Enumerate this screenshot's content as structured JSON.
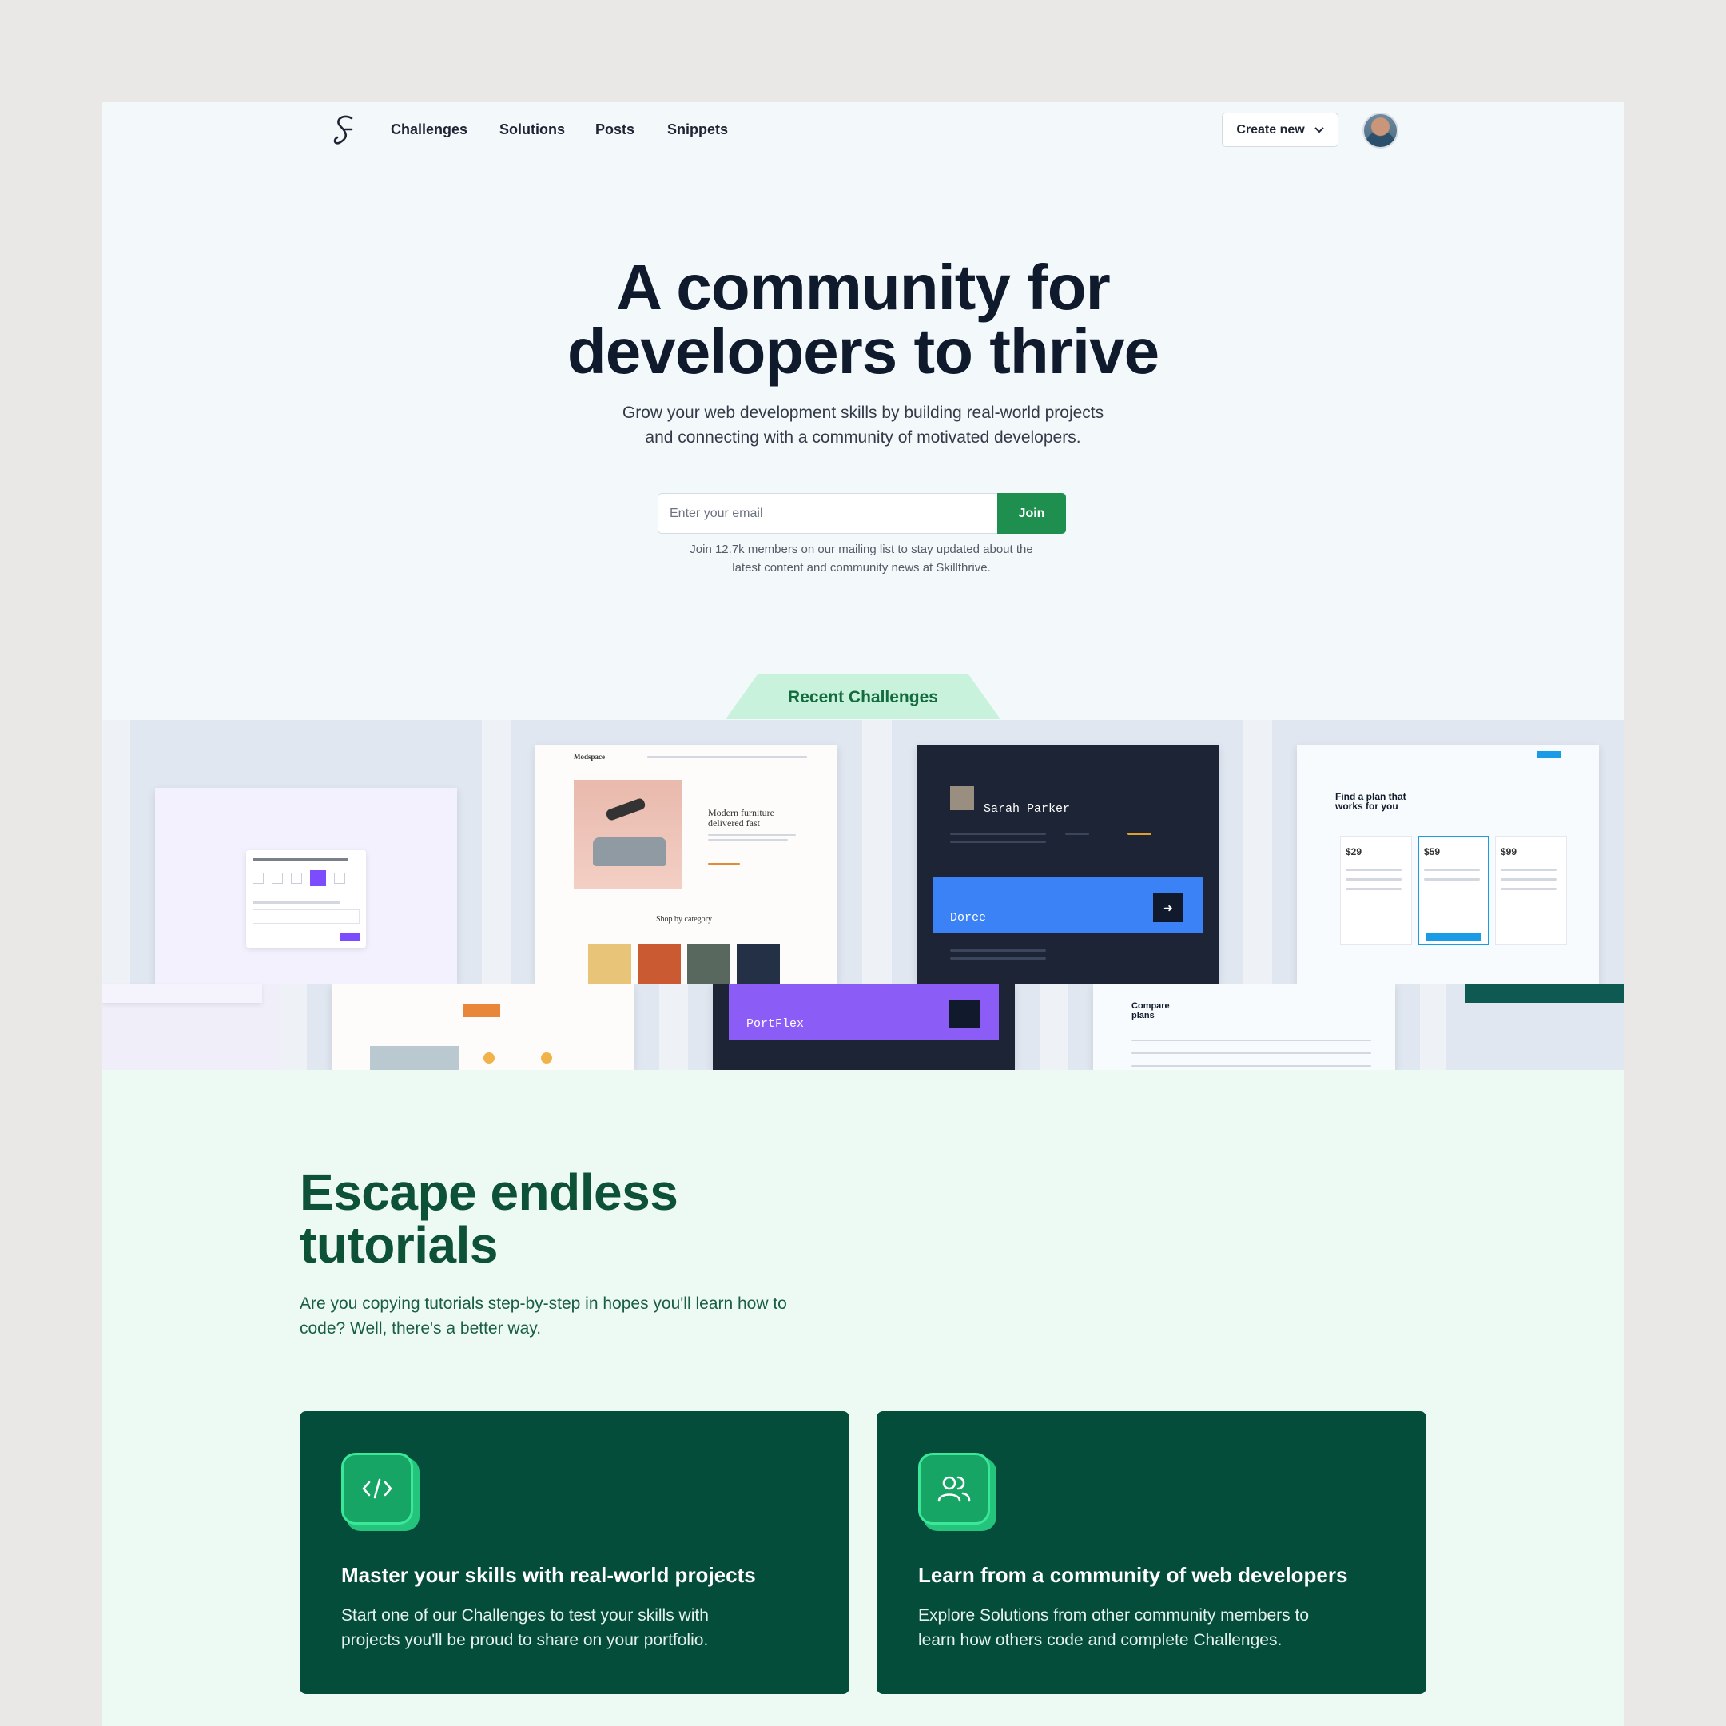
{
  "nav": {
    "links": [
      "Challenges",
      "Solutions",
      "Posts",
      "Snippets"
    ],
    "create_label": "Create new"
  },
  "hero": {
    "title_line1": "A community for",
    "title_line2": "developers to thrive",
    "subtitle_line1": "Grow your web development skills by building real-world projects",
    "subtitle_line2": "and connecting with a community of motivated developers.",
    "email_placeholder": "Enter your email",
    "join_label": "Join",
    "note_line1": "Join 12.7k members on our mailing list to stay updated about the",
    "note_line2": "latest content and community news at Skillthrive."
  },
  "challenges": {
    "tab_label": "Recent Challenges",
    "furniture": {
      "brand": "Modspace",
      "headline1": "Modern furniture",
      "headline2": "delivered fast",
      "shop": "Shop by category"
    },
    "portfolio": {
      "name": "Sarah Parker",
      "project": "Doree"
    },
    "pricing": {
      "heading1": "Find a plan that",
      "heading2": "works for you",
      "prices": [
        "$29",
        "$59",
        "$99"
      ],
      "compare1": "Compare",
      "compare2": "plans"
    },
    "portflex": "PortFlex"
  },
  "escape": {
    "title_line1": "Escape endless",
    "title_line2": "tutorials",
    "subtitle_line1": "Are you copying tutorials step-by-step in hopes you'll learn how to",
    "subtitle_line2": "code? Well, there's a better way.",
    "cards": [
      {
        "icon": "code-icon",
        "title": "Master your skills with real-world projects",
        "line1": "Start one of our Challenges to test your skills with",
        "line2": "projects you'll be proud to share on your portfolio."
      },
      {
        "icon": "users-icon",
        "title": "Learn from a community of web developers",
        "line1": "Explore Solutions from other community members to",
        "line2": "learn how others code and complete Challenges."
      }
    ]
  },
  "colors": {
    "brand_green": "#1e8f4e",
    "dark_green": "#054d3b",
    "mint": "#ecfaf3",
    "heading": "#0f1a2c"
  }
}
